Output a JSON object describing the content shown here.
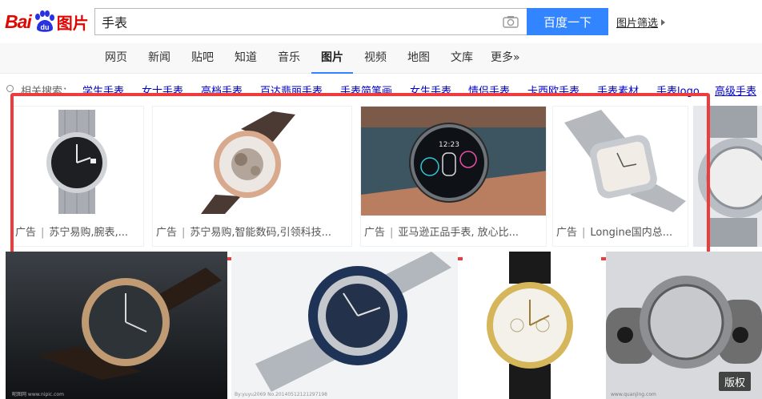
{
  "logo": {
    "brand_text": "Bai",
    "paw_text": "du",
    "product_text": "图片"
  },
  "search": {
    "query": "手表",
    "button_label": "百度一下",
    "filter_label": "图片筛选"
  },
  "tabs": [
    {
      "label": "网页"
    },
    {
      "label": "新闻"
    },
    {
      "label": "贴吧"
    },
    {
      "label": "知道"
    },
    {
      "label": "音乐"
    },
    {
      "label": "图片"
    },
    {
      "label": "视频"
    },
    {
      "label": "地图"
    },
    {
      "label": "文库"
    },
    {
      "label": "更多»"
    }
  ],
  "active_tab": "图片",
  "related": {
    "label": "相关搜索：",
    "items": [
      {
        "label": "学生手表"
      },
      {
        "label": "女士手表"
      },
      {
        "label": "高档手表"
      },
      {
        "label": "百达翡丽手表"
      },
      {
        "label": "手表简笔画"
      },
      {
        "label": "女生手表"
      },
      {
        "label": "情侣手表"
      },
      {
        "label": "卡西欧手表"
      },
      {
        "label": "手表素材"
      },
      {
        "label": "手表logo"
      },
      {
        "label": "高级手表"
      }
    ]
  },
  "ads": [
    {
      "tag": "广告",
      "text": "苏宁易购,腕表,..."
    },
    {
      "tag": "广告",
      "text": "苏宁易购,智能数码,引领科技..."
    },
    {
      "tag": "广告",
      "text": "亚马逊正品手表, 放心比..."
    },
    {
      "tag": "广告",
      "text": "Longine国内总..."
    }
  ],
  "results": {
    "copyright_badge": "版权"
  },
  "colors": {
    "brand_red": "#e10602",
    "primary_blue": "#3385ff",
    "highlight_red": "#ee3b3b",
    "link_blue": "#0000cc"
  }
}
